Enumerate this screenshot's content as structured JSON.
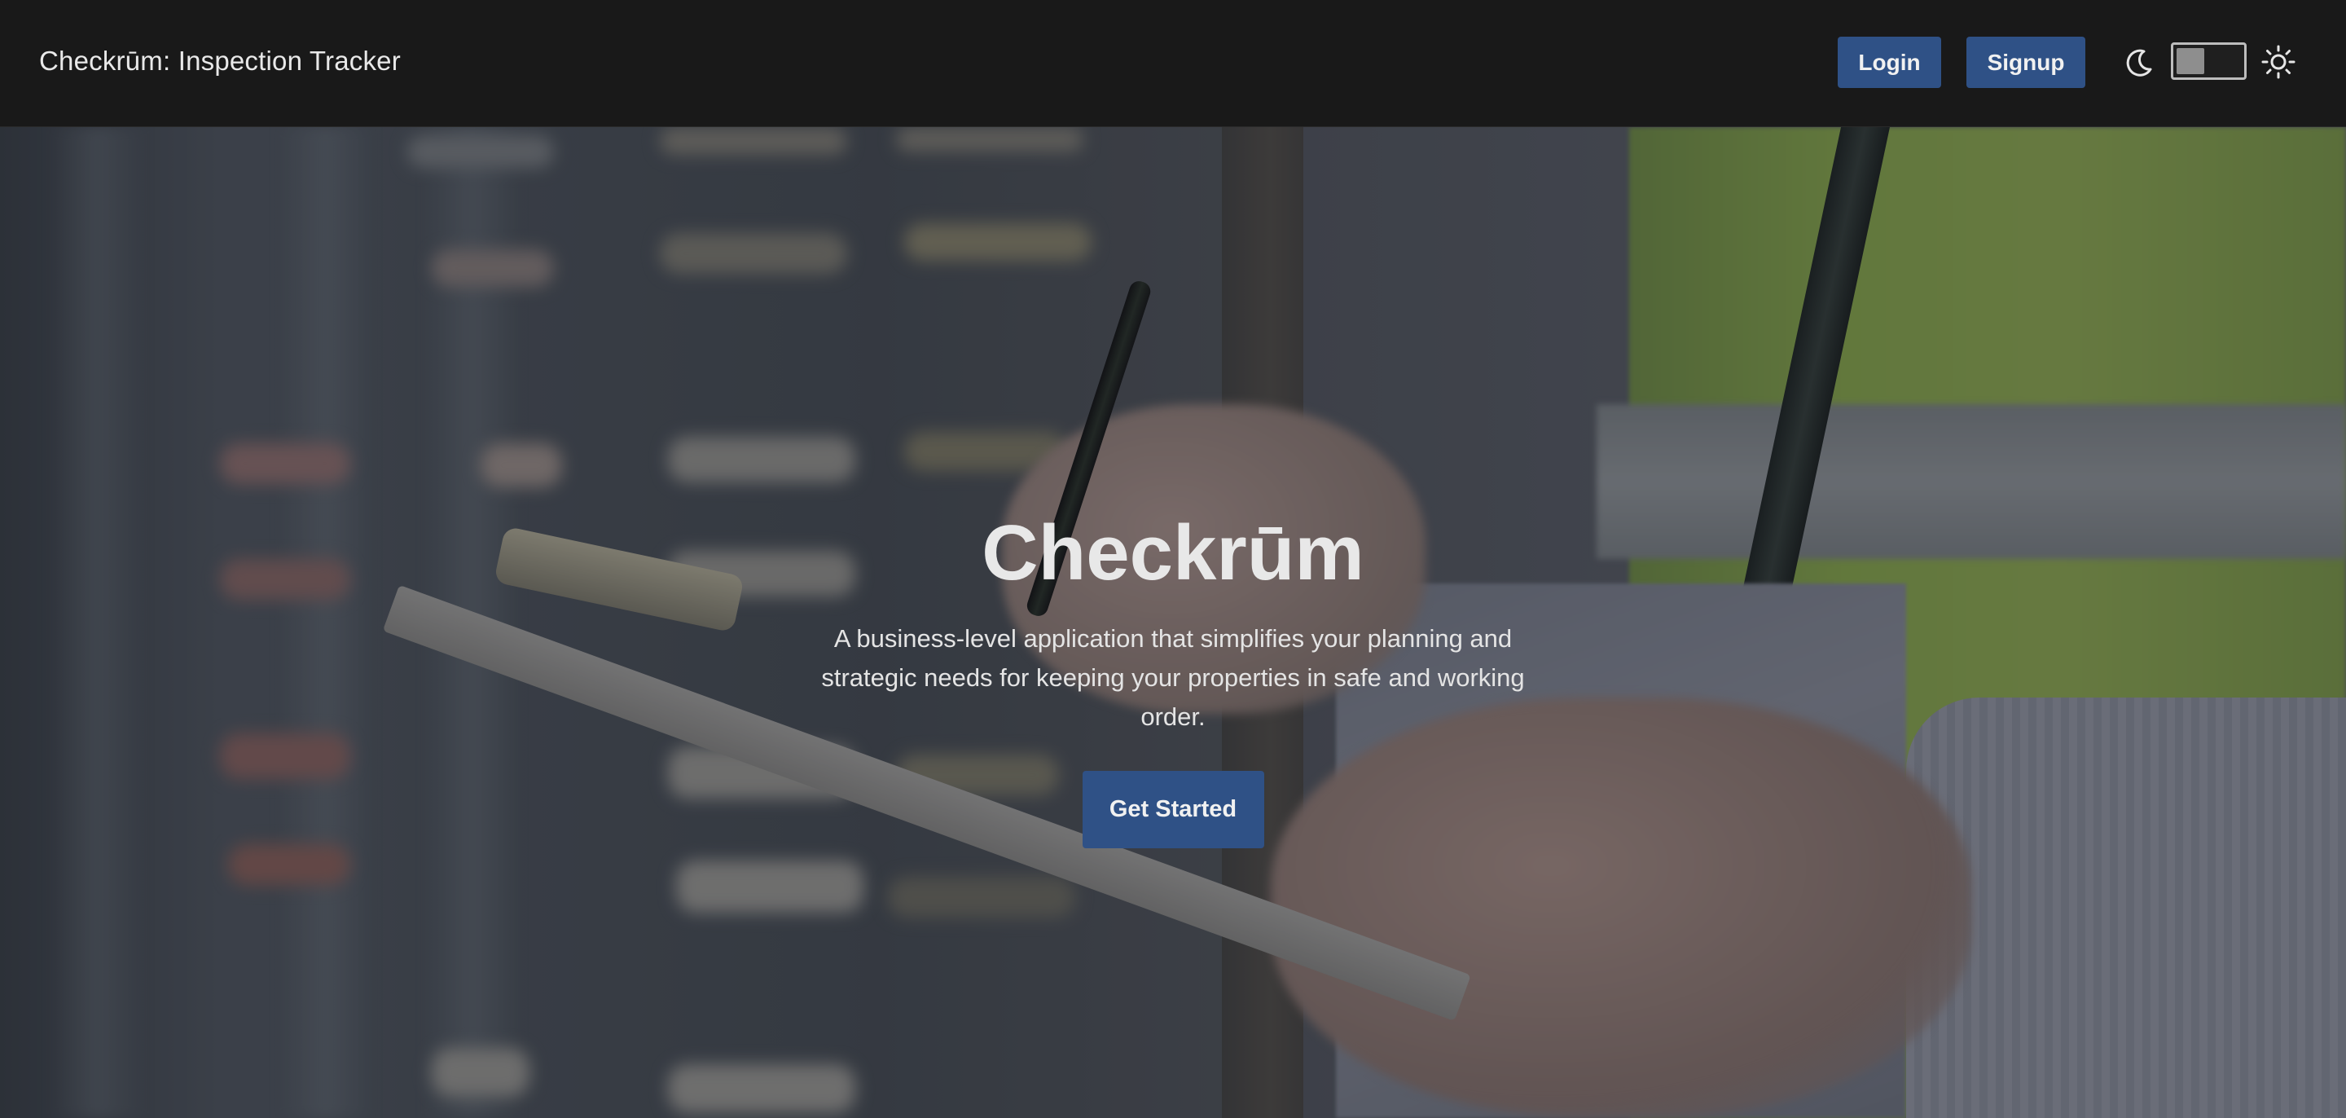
{
  "navbar": {
    "brand": "Checkrūm: Inspection Tracker",
    "login_label": "Login",
    "signup_label": "Signup",
    "theme_toggle": {
      "left_icon": "moon-icon",
      "right_icon": "sun-icon",
      "state": "dark"
    }
  },
  "hero": {
    "title": "Checkrūm",
    "subtitle": "A business-level application that simplifies your planning and strategic needs for keeping your properties in safe and working order.",
    "cta_label": "Get Started",
    "background_image": "inspector-with-clipboard-photo"
  },
  "colors": {
    "navbar_bg": "#191919",
    "button_bg": "#2f5186",
    "button_text": "#f1f1f1",
    "text_light": "#e8e8e8"
  }
}
